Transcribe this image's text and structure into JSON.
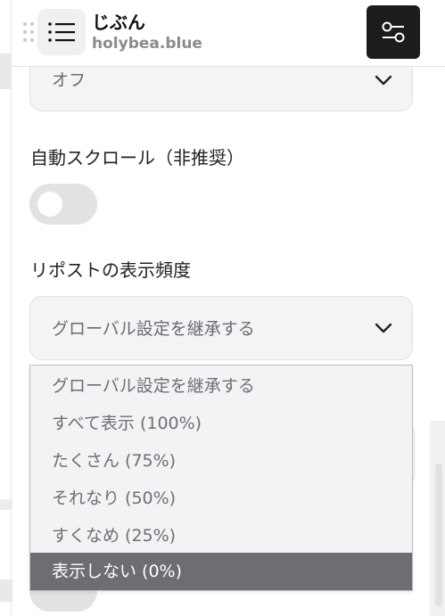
{
  "header": {
    "title": "じぶん",
    "subtitle": "holybea.blue",
    "menu_icon": "list-icon",
    "settings_icon": "toggle-sliders-icon"
  },
  "settings": {
    "previous_select": {
      "value": "オフ",
      "icon": "chevron-down-icon"
    },
    "auto_scroll": {
      "label": "自動スクロール（非推奨）",
      "enabled": false
    },
    "repost_frequency": {
      "label": "リポストの表示頻度",
      "value": "グローバル設定を継承する",
      "icon": "chevron-down-icon",
      "options": [
        "グローバル設定を継承する",
        "すべて表示 (100%)",
        "たくさん (75%)",
        "それなり (50%)",
        "すくなめ (25%)",
        "表示しない (0%)"
      ],
      "highlighted_option": "表示しない (0%)"
    }
  },
  "colors": {
    "settings_button_bg": "#1c1c1e",
    "highlight_bg": "#6e6e72",
    "field_bg": "#f4f4f6"
  }
}
